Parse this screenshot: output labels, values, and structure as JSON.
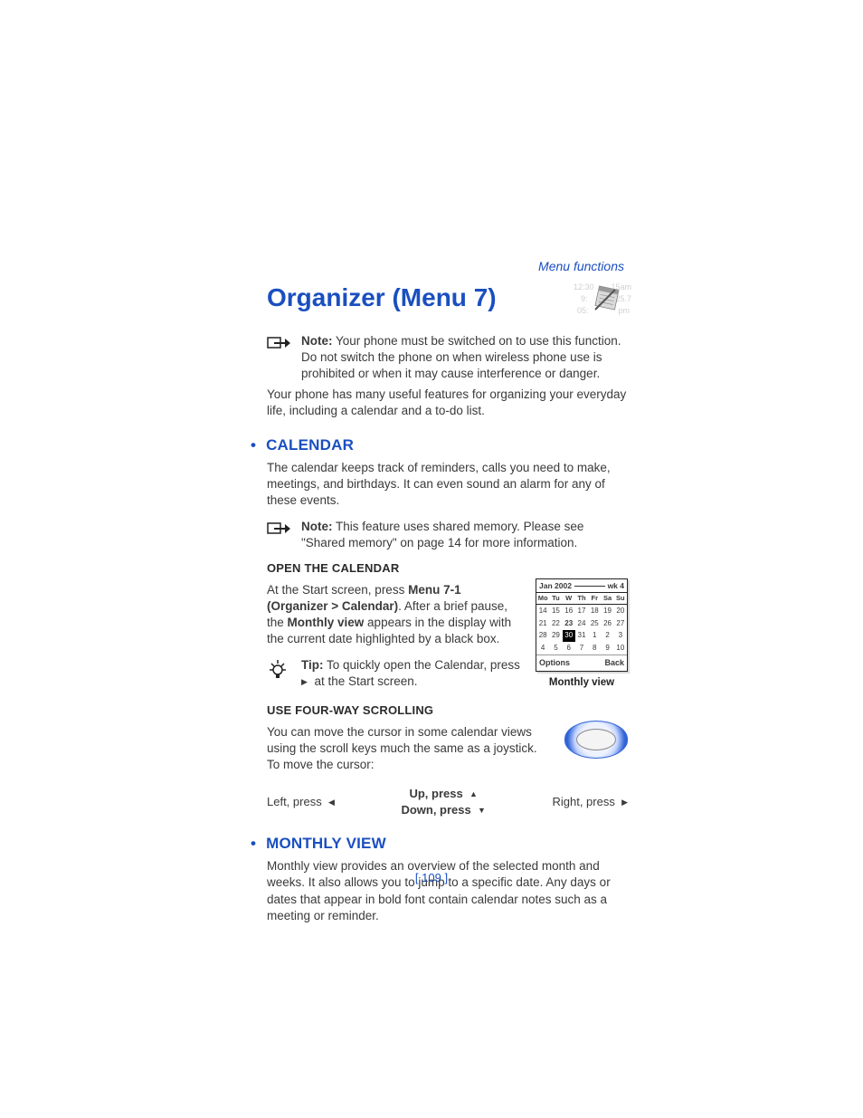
{
  "header": "Menu functions",
  "title": "Organizer (Menu 7)",
  "title_icon": {
    "name": "organizer-notepad-icon",
    "ghost_lines": [
      "12:30",
      "15am",
      "9:",
      "25.7",
      "05:",
      "pm"
    ]
  },
  "note1": {
    "label": "Note:",
    "text": "Your phone must be switched on to use this function. Do not switch the phone on when wireless phone use is prohibited or when it may cause interference or danger."
  },
  "intro": "Your phone has many useful features for organizing your everyday life, including a calendar and a to-do list.",
  "calendar": {
    "heading": "CALENDAR",
    "text": "The calendar keeps track of reminders, calls you need to make, meetings, and birthdays. It can even sound an alarm for any of these events.",
    "note": {
      "label": "Note:",
      "text": "This feature uses shared memory. Please see \"Shared memory\" on page 14 for more information."
    },
    "open": {
      "heading": "OPEN THE CALENDAR",
      "p1_a": "At the Start screen, press ",
      "p1_b": "Menu 7-1 (Organizer > Calendar)",
      "p1_c": ". After a brief pause, the ",
      "p1_d": "Monthly view",
      "p1_e": " appears in the display with the current date highlighted by a black box."
    },
    "tip": {
      "label": "Tip:",
      "text_a": "To quickly open the Calendar, press ",
      "text_b": "at the Start screen."
    },
    "screen": {
      "month": "Jan 2002",
      "week": "wk 4",
      "days": [
        "Mo",
        "Tu",
        "W",
        "Th",
        "Fr",
        "Sa",
        "Su"
      ],
      "rows": [
        [
          "14",
          "15",
          "16",
          "17",
          "18",
          "19",
          "20"
        ],
        [
          "21",
          "22",
          "23",
          "24",
          "25",
          "26",
          "27"
        ],
        [
          "28",
          "29",
          "30",
          "31",
          "1",
          "2",
          "3"
        ],
        [
          "4",
          "5",
          "6",
          "7",
          "8",
          "9",
          "10"
        ]
      ],
      "bold_cell": "23",
      "highlight_cell": "30",
      "soft_left": "Options",
      "soft_right": "Back",
      "caption": "Monthly view"
    },
    "scroll": {
      "heading": "USE FOUR-WAY SCROLLING",
      "text": "You can move the cursor in some calendar views using the scroll keys much the same as a joystick. To move the cursor:",
      "dirs": {
        "left": "Left, press",
        "up": "Up, press",
        "down": "Down, press",
        "right": "Right, press"
      }
    }
  },
  "monthly": {
    "heading": "MONTHLY VIEW",
    "text": "Monthly view provides an overview of the selected month and weeks. It also allows you to jump to a specific date. Any days or dates that appear in bold font contain calendar notes such as a meeting or reminder."
  },
  "page_number": "[ 109 ]"
}
